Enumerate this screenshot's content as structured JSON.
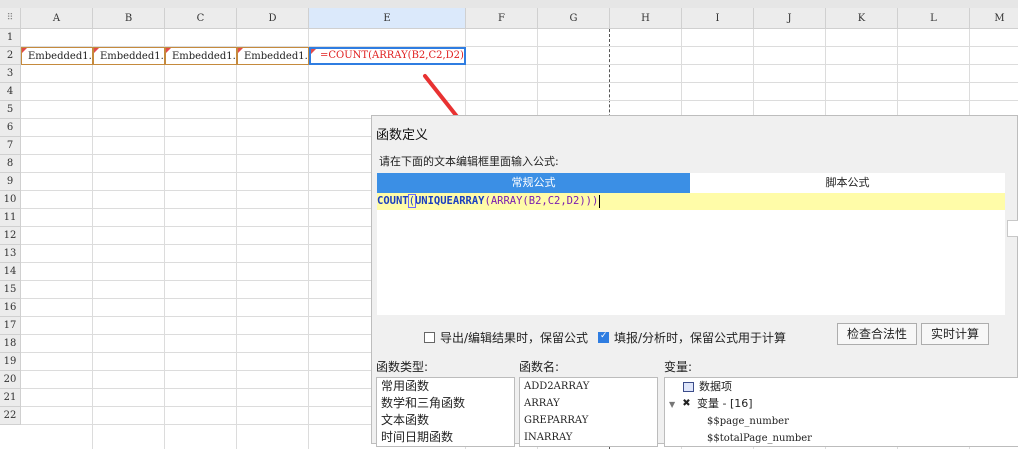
{
  "sheet": {
    "columns": [
      "A",
      "B",
      "C",
      "D",
      "E",
      "F",
      "G",
      "H",
      "I",
      "J",
      "K",
      "L",
      "M"
    ],
    "rows": [
      "1",
      "2",
      "3",
      "4",
      "5",
      "6",
      "7",
      "8",
      "9",
      "10",
      "11",
      "12",
      "13",
      "14",
      "15",
      "16",
      "17",
      "18",
      "19",
      "20",
      "21",
      "22"
    ],
    "cells": {
      "A2": "Embedded1.",
      "B2": "Embedded1.",
      "C2": "Embedded1.",
      "D2": "Embedded1.",
      "E2": "=COUNT(ARRAY(B2,C2,D2))"
    },
    "selected_column": "E"
  },
  "dialog": {
    "title": "函数定义",
    "prompt": "请在下面的文本编辑框里面输入公式:",
    "tabs": {
      "normal": "常规公式",
      "script": "脚本公式"
    },
    "formula": {
      "t1": "COUNT",
      "t2": "(",
      "t3": "UNIQUEARRAY",
      "t4": "(",
      "t5": "ARRAY",
      "t6": "(",
      "t7": "B2,C2,D2",
      "t8": ")))"
    },
    "options": {
      "export_keep": "导出/编辑结果时，保留公式",
      "fill_keep": "填报/分析时，保留公式用于计算",
      "export_checked": false,
      "fill_checked": true
    },
    "buttons": {
      "check": "检查合法性",
      "realtime": "实时计算"
    },
    "sections": {
      "category": "函数类型:",
      "name": "函数名:",
      "variable": "变量:"
    },
    "categories": [
      "常用函数",
      "数学和三角函数",
      "文本函数",
      "时间日期函数"
    ],
    "functions": [
      "ADD2ARRAY",
      "ARRAY",
      "GREPARRAY",
      "INARRAY"
    ],
    "variables": {
      "data_items": "数据项",
      "vars_label": "变量 - [16]",
      "page_number": "$$page_number",
      "total_page_number": "$$totalPage_number"
    }
  },
  "colors": {
    "accent": "#3b8fe5",
    "arrow": "#e83232",
    "formula_red": "#e02020",
    "editor_bg": "#fffca8"
  }
}
